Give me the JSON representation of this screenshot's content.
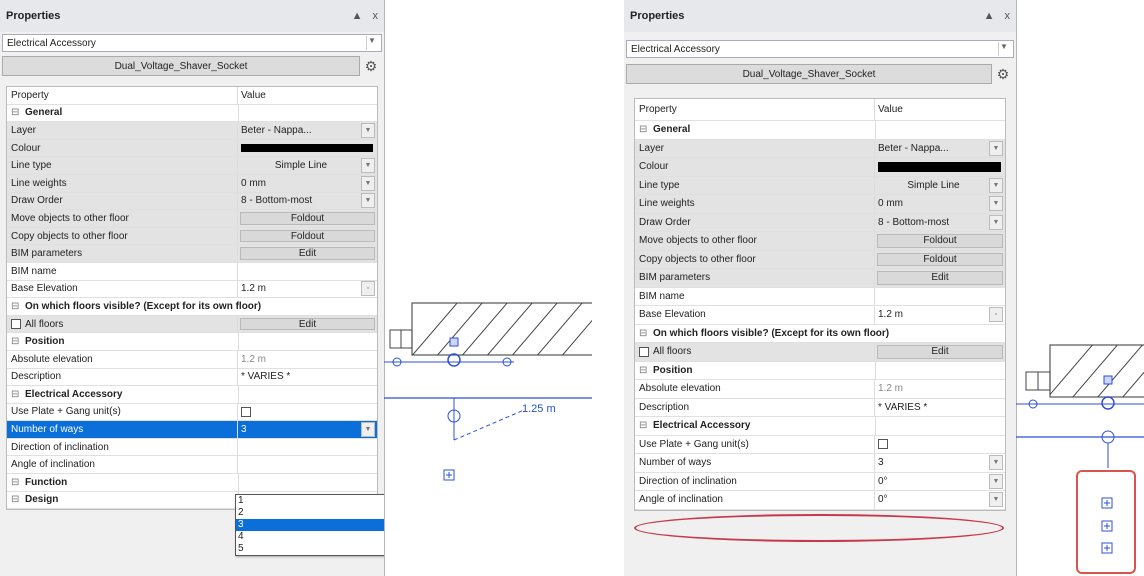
{
  "panel": {
    "title": "Properties",
    "pin_icon": "pin-icon",
    "close_label": "x",
    "type_selector": "Electrical Accessory",
    "family_name": "Dual_Voltage_Shaver_Socket",
    "settings_icon": "gear-icon"
  },
  "columns": {
    "property": "Property",
    "value": "Value"
  },
  "rows": {
    "general": "General",
    "layer": {
      "label": "Layer",
      "value": "Beter - Nappa..."
    },
    "colour": {
      "label": "Colour"
    },
    "line_type": {
      "label": "Line type",
      "value": "Simple Line"
    },
    "line_weights": {
      "label": "Line weights",
      "value": "0 mm"
    },
    "draw_order": {
      "label": "Draw Order",
      "value": "8 - Bottom-most"
    },
    "move_objects": {
      "label": "Move objects to other floor",
      "value": "Foldout"
    },
    "copy_objects": {
      "label": "Copy objects to other floor",
      "value": "Foldout"
    },
    "bim_params": {
      "label": "BIM parameters",
      "value": "Edit"
    },
    "bim_name": {
      "label": "BIM name"
    },
    "base_elevation": {
      "label": "Base Elevation",
      "value": "1.2 m"
    },
    "floors_visible": "On which floors visible? (Except for its own floor)",
    "all_floors": {
      "label": "All floors",
      "value": "Edit"
    },
    "position": "Position",
    "abs_elevation": {
      "label": "Absolute elevation",
      "value": "1.2 m"
    },
    "description": {
      "label": "Description",
      "value": "* VARIES *"
    },
    "electrical": "Electrical Accessory",
    "use_plate": {
      "label": "Use Plate + Gang unit(s)"
    },
    "num_ways": {
      "label": "Number of ways",
      "value": "3"
    },
    "direction": {
      "label": "Direction of inclination",
      "value": "0°"
    },
    "angle": {
      "label": "Angle of inclination",
      "value": "0°"
    },
    "function": "Function",
    "design": "Design"
  },
  "dropdown_options": [
    "1",
    "2",
    "3",
    "4",
    "5"
  ],
  "dropdown_selected": "3",
  "right_num_ways_value": "3",
  "canvas_dimension": "1.25 m",
  "accent_colors": {
    "selection": "#0a6fd8",
    "annotation": "#d9534f",
    "drawing": "#1f54c8"
  }
}
